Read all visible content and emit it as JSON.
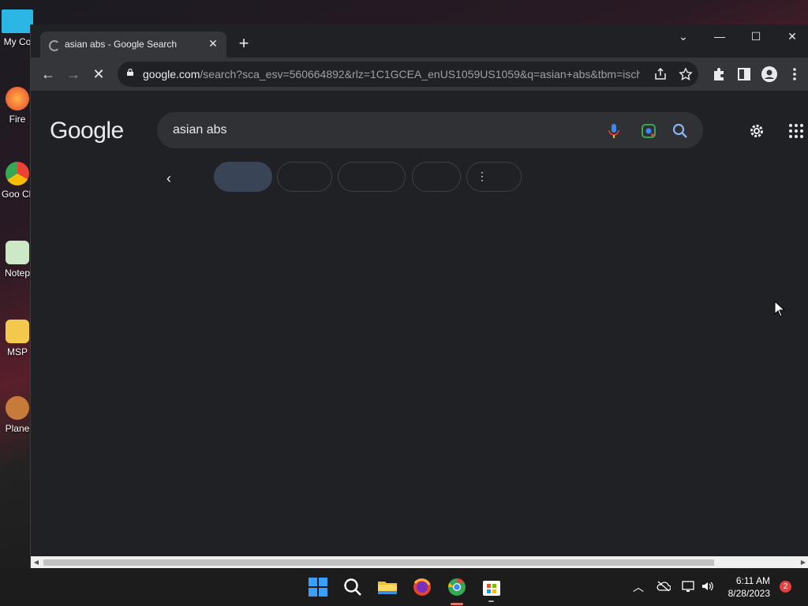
{
  "desktop": {
    "icons": [
      {
        "label": "My Co",
        "color": "#2bb6e6"
      },
      {
        "label": "Fire",
        "color": "#ff6b2b"
      },
      {
        "label": "Goo Chr",
        "color": "#34a853"
      },
      {
        "label": "Notep",
        "color": "#4caf50"
      },
      {
        "label": "MSP",
        "color": "#f2c94c"
      },
      {
        "label": "Plane",
        "color": "#c77b3a"
      }
    ]
  },
  "browser": {
    "tab_title": "asian abs - Google Search",
    "tab_close_glyph": "✕",
    "new_tab_glyph": "+",
    "window_controls": {
      "dropdown": "⌄",
      "minimize": "—",
      "maximize": "☐",
      "close": "✕"
    },
    "url_host": "google.com",
    "url_rest": "/search?sca_esv=560664892&rlz=1C1GCEA_enUS1059US1059&q=asian+abs&tbm=isch...",
    "nav": {
      "back": "←",
      "forward": "→",
      "stop": "✕"
    },
    "toolbar_icons": [
      "share-icon",
      "star-icon",
      "extensions-icon",
      "side-panel-icon",
      "profile-icon",
      "menu-icon"
    ]
  },
  "google": {
    "logo_text": "Google",
    "query": "asian abs",
    "chip_back": "‹",
    "chip_more": "⋮",
    "accent": "#8ab4f8",
    "mic_color": "#4285f4"
  },
  "taskbar": {
    "time": "6:11 AM",
    "date": "8/28/2023",
    "notifications": "2",
    "apps": [
      "start-icon",
      "search-icon",
      "file-explorer-icon",
      "firefox-icon",
      "chrome-icon",
      "store-icon"
    ]
  }
}
